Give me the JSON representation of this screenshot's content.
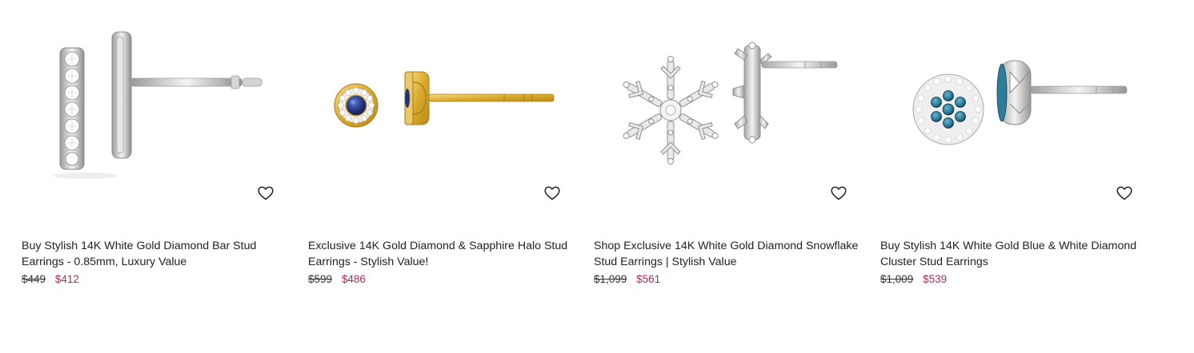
{
  "products": [
    {
      "title": "Buy Stylish 14K White Gold Diamond Bar Stud Earrings - 0.85mm, Luxury Value",
      "old_price": "$449",
      "price": "$412",
      "image_icon": "bar-stud-earrings-image",
      "wishlist_icon": "heart-outline-icon"
    },
    {
      "title": "Exclusive 14K Gold Diamond & Sapphire Halo Stud Earrings - Stylish Value!",
      "old_price": "$599",
      "price": "$486",
      "image_icon": "halo-stud-earrings-image",
      "wishlist_icon": "heart-outline-icon"
    },
    {
      "title": "Shop Exclusive 14K White Gold Diamond Snowflake Stud Earrings | Stylish Value",
      "old_price": "$1,099",
      "price": "$561",
      "image_icon": "snowflake-stud-earrings-image",
      "wishlist_icon": "heart-outline-icon"
    },
    {
      "title": "Buy Stylish 14K White Gold Blue & White Diamond Cluster Stud Earrings",
      "old_price": "$1,009",
      "price": "$539",
      "image_icon": "cluster-stud-earrings-image",
      "wishlist_icon": "heart-outline-icon"
    }
  ],
  "colors": {
    "sale_price": "#b0285a",
    "old_price": "#333333",
    "title": "#222222",
    "metal_silver": "#d9d9d9",
    "metal_gold": "#e3bf4f",
    "sapphire": "#22337a",
    "blue_diamond": "#2d7d9a"
  }
}
